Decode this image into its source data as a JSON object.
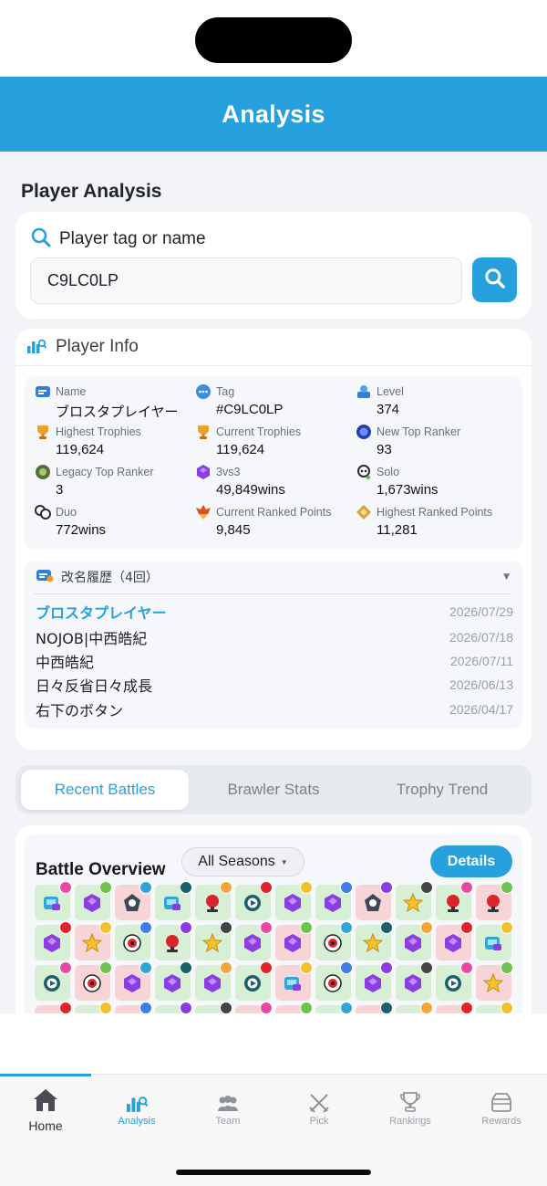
{
  "app": {
    "title": "Analysis"
  },
  "page": {
    "section_title": "Player Analysis"
  },
  "search": {
    "label": "Player tag or name",
    "value": "C9LC0LP",
    "icon": "search-icon"
  },
  "player_info": {
    "heading": "Player Info",
    "stats": [
      {
        "label": "Name",
        "value": "ブロスタプレイヤー",
        "icon": "name-icon"
      },
      {
        "label": "Tag",
        "value": "#C9LC0LP",
        "icon": "tag-icon"
      },
      {
        "label": "Level",
        "value": "374",
        "icon": "level-icon"
      },
      {
        "label": "Highest Trophies",
        "value": "119,624",
        "icon": "trophy-icon"
      },
      {
        "label": "Current Trophies",
        "value": "119,624",
        "icon": "trophy-icon"
      },
      {
        "label": "New Top Ranker",
        "value": "93",
        "icon": "ranker-icon"
      },
      {
        "label": "Legacy Top Ranker",
        "value": "3",
        "icon": "legacy-ranker-icon"
      },
      {
        "label": "3vs3",
        "value": "49,849wins",
        "icon": "gem-icon"
      },
      {
        "label": "Solo",
        "value": "1,673wins",
        "icon": "skull-icon"
      },
      {
        "label": "Duo",
        "value": "772wins",
        "icon": "duo-skull-icon"
      },
      {
        "label": "Current Ranked Points",
        "value": "9,845",
        "icon": "ranked-icon"
      },
      {
        "label": "Highest Ranked Points",
        "value": "11,281",
        "icon": "ranked-highest-icon"
      }
    ],
    "name_history": {
      "title": "改名履歴（4回）",
      "entries": [
        {
          "name": "ブロスタプレイヤー",
          "date": "2026/07/29",
          "current": true
        },
        {
          "name": "NOJOB|中西皓紀",
          "date": "2026/07/18",
          "current": false
        },
        {
          "name": "中西皓紀",
          "date": "2026/07/11",
          "current": false
        },
        {
          "name": "日々反省日々成長",
          "date": "2026/06/13",
          "current": false
        },
        {
          "name": "右下のボタン",
          "date": "2026/04/17",
          "current": false
        }
      ]
    }
  },
  "tabs": {
    "recent_battles": "Recent Battles",
    "brawler_stats": "Brawler Stats",
    "trophy_trend": "Trophy Trend",
    "active": "Recent Battles"
  },
  "battle_overview": {
    "title": "Battle Overview",
    "season_filter": "All Seasons",
    "details_label": "Details",
    "rows": [
      [
        "win-bounty",
        "win-gem",
        "loss-heist",
        "win-bounty",
        "win-brawlball",
        "win-knockout",
        "win-gem",
        "win-gem",
        "loss-heist",
        "win-star",
        "win-brawlball",
        "loss-brawlball"
      ],
      [
        "win-gem",
        "loss-star",
        "win-hotzone",
        "win-brawlball",
        "win-star",
        "win-gem",
        "loss-gem",
        "win-hotzone",
        "win-star",
        "win-gem",
        "loss-gem",
        "win-bounty"
      ],
      [
        "win-knockout",
        "loss-hotzone",
        "loss-gem",
        "win-gem",
        "win-gem",
        "win-knockout",
        "loss-bounty",
        "win-hotzone",
        "win-gem",
        "win-gem",
        "win-knockout",
        "loss-star"
      ],
      [
        "loss-gem",
        "win-knockout",
        "loss-star",
        "win-knockout",
        "win-hotzone",
        "loss-gem",
        "loss-brawlball",
        "win-star",
        "loss-gem",
        "win-knockout",
        "loss-gem",
        "win-hotzone"
      ]
    ],
    "colors": {
      "win": "#d6efd5",
      "loss": "#f7d4d6",
      "accent": "#27a1de"
    }
  },
  "nav": [
    {
      "label": "Home",
      "icon": "home-icon"
    },
    {
      "label": "Analysis",
      "icon": "analysis-icon",
      "active": true
    },
    {
      "label": "Team",
      "icon": "team-icon"
    },
    {
      "label": "Pick",
      "icon": "pick-icon"
    },
    {
      "label": "Rankings",
      "icon": "rankings-icon"
    },
    {
      "label": "Rewards",
      "icon": "rewards-icon"
    }
  ]
}
